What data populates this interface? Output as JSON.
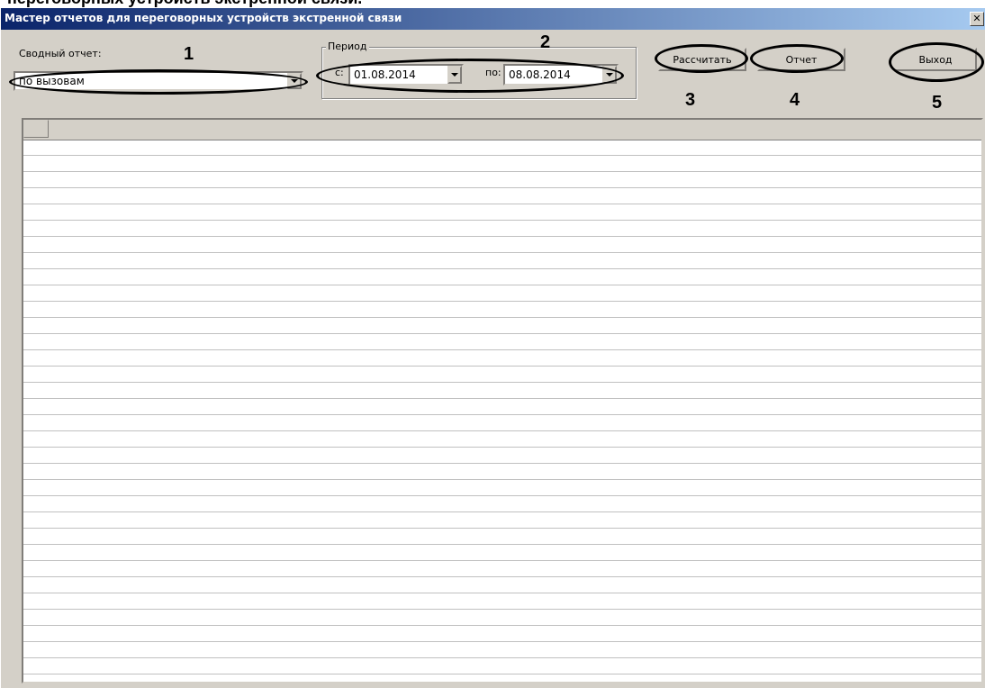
{
  "doc_heading": "переговорных устройств экстренной связи.",
  "window": {
    "title": "Мастер отчетов для переговорных устройств экстренной связи",
    "close_icon": "close-icon"
  },
  "summary": {
    "label": "Сводный отчет:",
    "value": "по вызовам"
  },
  "period": {
    "legend": "Период",
    "from_label": "с:",
    "from_value": "01.08.2014",
    "to_label": "по:",
    "to_value": "08.08.2014"
  },
  "buttons": {
    "calculate": "Рассчитать",
    "report": "Отчет",
    "exit": "Выход"
  },
  "callouts": [
    "1",
    "2",
    "3",
    "4",
    "5"
  ]
}
